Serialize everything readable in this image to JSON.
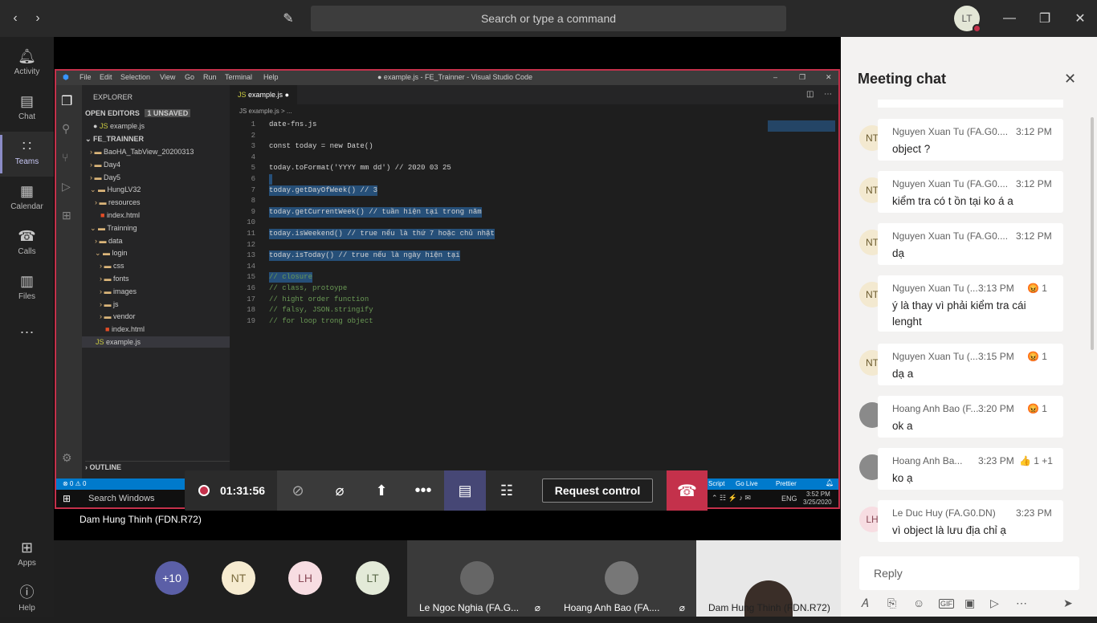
{
  "topbar": {
    "search_placeholder": "Search or type a command",
    "user_initials": "LT"
  },
  "rail": [
    {
      "label": "Activity",
      "icon": "bell-icon"
    },
    {
      "label": "Chat",
      "icon": "chat-icon"
    },
    {
      "label": "Teams",
      "icon": "teams-icon"
    },
    {
      "label": "Calendar",
      "icon": "calendar-icon"
    },
    {
      "label": "Calls",
      "icon": "phone-icon"
    },
    {
      "label": "Files",
      "icon": "files-icon"
    },
    {
      "label": "Apps",
      "icon": "apps-icon"
    },
    {
      "label": "Help",
      "icon": "help-icon"
    }
  ],
  "vscode": {
    "menu": [
      "File",
      "Edit",
      "Selection",
      "View",
      "Go",
      "Run",
      "Terminal",
      "Help"
    ],
    "title": "● example.js - FE_Trainner - Visual Studio Code",
    "explorer_label": "EXPLORER",
    "open_editors_label": "OPEN EDITORS",
    "unsaved_badge": "1 UNSAVED",
    "open_file": "example.js",
    "root_folder": "FE_TRAINNER",
    "tree": [
      {
        "name": "BaoHA_TabView_20200313",
        "depth": 1,
        "kind": "folder"
      },
      {
        "name": "Day4",
        "depth": 1,
        "kind": "folder"
      },
      {
        "name": "Day5",
        "depth": 1,
        "kind": "folder"
      },
      {
        "name": "HungLV32",
        "depth": 1,
        "kind": "folder-open"
      },
      {
        "name": "resources",
        "depth": 2,
        "kind": "folder"
      },
      {
        "name": "index.html",
        "depth": 2,
        "kind": "html"
      },
      {
        "name": "Trainning",
        "depth": 1,
        "kind": "folder-open"
      },
      {
        "name": "data",
        "depth": 2,
        "kind": "folder"
      },
      {
        "name": "login",
        "depth": 2,
        "kind": "folder-open"
      },
      {
        "name": "css",
        "depth": 3,
        "kind": "folder"
      },
      {
        "name": "fonts",
        "depth": 3,
        "kind": "folder"
      },
      {
        "name": "images",
        "depth": 3,
        "kind": "folder"
      },
      {
        "name": "js",
        "depth": 3,
        "kind": "folder"
      },
      {
        "name": "vendor",
        "depth": 3,
        "kind": "folder"
      },
      {
        "name": "index.html",
        "depth": 3,
        "kind": "html"
      },
      {
        "name": "example.js",
        "depth": 1,
        "kind": "js"
      }
    ],
    "outline_label": "OUTLINE",
    "tab_label": "example.js",
    "breadcrumb": "JS example.js > ...",
    "code": [
      {
        "n": "1",
        "t": "date-fns.js",
        "sel": false
      },
      {
        "n": "2",
        "t": "",
        "sel": false
      },
      {
        "n": "3",
        "t": "const today = new Date()",
        "sel": false
      },
      {
        "n": "4",
        "t": "",
        "sel": false
      },
      {
        "n": "5",
        "t": "today.toFormat('YYYY mm dd') // 2020 03 25",
        "sel": false
      },
      {
        "n": "6",
        "t": "",
        "sel": true
      },
      {
        "n": "7",
        "t": "today.getDayOfWeek() // 3",
        "sel": true
      },
      {
        "n": "8",
        "t": "",
        "sel": false
      },
      {
        "n": "9",
        "t": "today.getCurrentWeek() // tuần hiện tại trong năm",
        "sel": true
      },
      {
        "n": "10",
        "t": "",
        "sel": false
      },
      {
        "n": "11",
        "t": "today.isWeekend() // true nếu là thứ 7 hoặc chủ nhật",
        "sel": true
      },
      {
        "n": "12",
        "t": "",
        "sel": false
      },
      {
        "n": "13",
        "t": "today.isToday() // true nếu là ngày hiện tại",
        "sel": true
      },
      {
        "n": "14",
        "t": "",
        "sel": false
      },
      {
        "n": "15",
        "t": "// closure",
        "sel": true
      },
      {
        "n": "16",
        "t": "// class, protoype",
        "sel": false
      },
      {
        "n": "17",
        "t": "// hight order function",
        "sel": false
      },
      {
        "n": "18",
        "t": "// falsy, JSON.stringify",
        "sel": false
      },
      {
        "n": "19",
        "t": "// for loop trong object",
        "sel": false
      }
    ],
    "status_left": "⊗ 0 ⚠ 0",
    "status_right": [
      "Script",
      "Go Live",
      "Prettier"
    ],
    "taskbar_search": "Search Windows",
    "taskbar_lang": "ENG",
    "taskbar_time": "3:52 PM",
    "taskbar_date": "3/25/2020"
  },
  "controls": {
    "timer": "01:31:56",
    "request_control": "Request control"
  },
  "presenter_name": "Dam Hung Thinh (FDN.R72)",
  "gallery": {
    "overflow": "+10",
    "avatars": [
      "NT",
      "LH",
      "LT"
    ],
    "tiles": [
      "Le Ngoc Nghia (FA.G...",
      "Hoang Anh Bao (FA....",
      "Dam Hung Thinh (FDN.R72)"
    ]
  },
  "chat": {
    "title": "Meeting chat",
    "messages": [
      {
        "initials": "NT",
        "author": "Nguyen Xuan Tu (FA.G0....",
        "time": "3:12 PM",
        "text": "object ?",
        "reaction": "",
        "photo": false
      },
      {
        "initials": "NT",
        "author": "Nguyen Xuan Tu (FA.G0....",
        "time": "3:12 PM",
        "text": "kiểm tra có t ồn tại ko á a",
        "reaction": "",
        "photo": false
      },
      {
        "initials": "NT",
        "author": "Nguyen Xuan Tu (FA.G0....",
        "time": "3:12 PM",
        "text": "dạ",
        "reaction": "",
        "photo": false
      },
      {
        "initials": "NT",
        "author": "Nguyen Xuan Tu (...",
        "time": "3:13 PM",
        "text": "ý là thay vì phải kiểm tra cái lenght",
        "reaction": "😡 1",
        "photo": false
      },
      {
        "initials": "NT",
        "author": "Nguyen Xuan Tu (...",
        "time": "3:15 PM",
        "text": "dạ a",
        "reaction": "😡 1",
        "photo": false
      },
      {
        "initials": "",
        "author": "Hoang Anh Bao (F...",
        "time": "3:20 PM",
        "text": "ok a",
        "reaction": "😡 1",
        "photo": true
      },
      {
        "initials": "",
        "author": "Hoang Anh Ba...",
        "time": "3:23 PM",
        "text": "ko ạ",
        "reaction": "👍 1  +1",
        "photo": true
      },
      {
        "initials": "LH",
        "author": "Le Duc Huy (FA.G0.DN)",
        "time": "3:23 PM",
        "text": "vì object là lưu địa chỉ ạ",
        "reaction": "",
        "photo": false
      }
    ],
    "reply_placeholder": "Reply"
  }
}
